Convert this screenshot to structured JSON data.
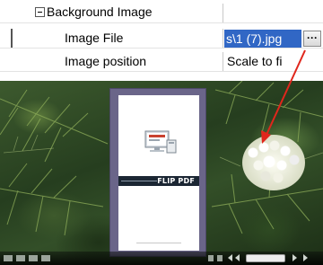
{
  "property_grid": {
    "category": {
      "label": "Background Image",
      "expander_icon": "collapse-minus-icon"
    },
    "rows": [
      {
        "name": "Image File",
        "value": "s\\1 (7).jpg",
        "button": "···"
      },
      {
        "name": "Image position",
        "value": "Scale to fi"
      }
    ]
  },
  "preview": {
    "book_banner": "FLIP PDF",
    "annotation_color": "#e0261c",
    "book_border_color": "#6a6589",
    "selection_color": "#3167c5"
  }
}
